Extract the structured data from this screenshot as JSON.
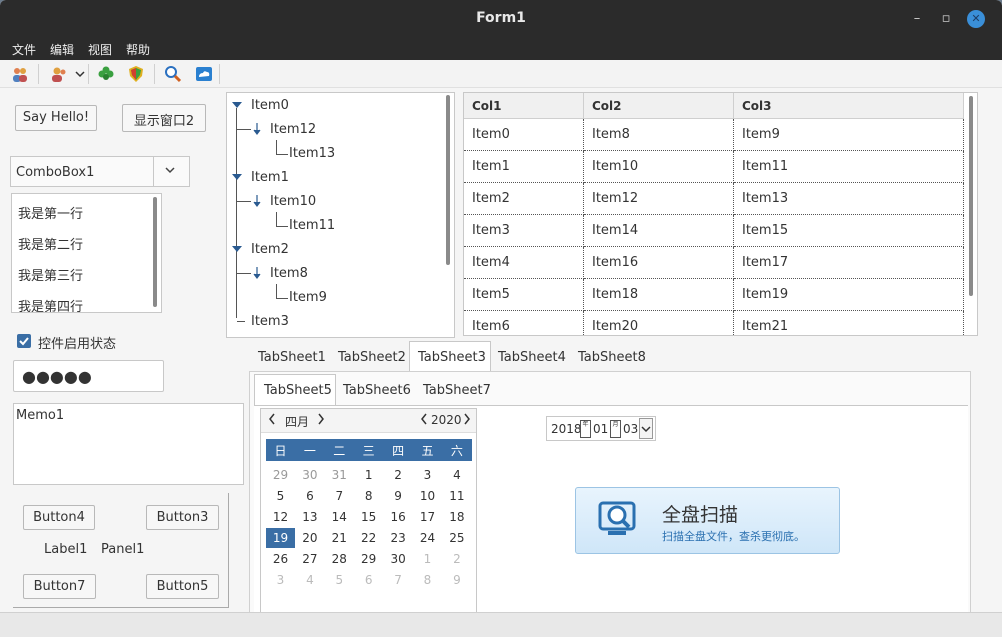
{
  "window": {
    "title": "Form1",
    "minimize": "–",
    "restore": "▫",
    "close": "✕"
  },
  "menu": [
    "文件",
    "编辑",
    "视图",
    "帮助"
  ],
  "toolbar_icons": [
    "users-icon",
    "user-dropdown-icon",
    "clover-icon",
    "shield-icon",
    "search-icon",
    "cloud-icon"
  ],
  "left": {
    "say_hello": "Say Hello!",
    "show_window2": "显示窗口2",
    "combobox": "ComboBox1",
    "listbox": [
      "我是第一行",
      "我是第二行",
      "我是第三行",
      "我是第四行"
    ],
    "checkbox_label": "控件启用状态",
    "password": "●●●●●",
    "memo": "Memo1",
    "button4": "Button4",
    "button3": "Button3",
    "label1": "Label1",
    "panel1": "Panel1",
    "button7": "Button7",
    "button5": "Button5"
  },
  "tree": [
    "Item0",
    "Item12",
    "Item13",
    "Item1",
    "Item10",
    "Item11",
    "Item2",
    "Item8",
    "Item9",
    "Item3"
  ],
  "grid": {
    "headers": [
      "Col1",
      "Col2",
      "Col3"
    ],
    "rows": [
      [
        "Item0",
        "Item8",
        "Item9"
      ],
      [
        "Item1",
        "Item10",
        "Item11"
      ],
      [
        "Item2",
        "Item12",
        "Item13"
      ],
      [
        "Item3",
        "Item14",
        "Item15"
      ],
      [
        "Item4",
        "Item16",
        "Item17"
      ],
      [
        "Item5",
        "Item18",
        "Item19"
      ],
      [
        "Item6",
        "Item20",
        "Item21"
      ]
    ]
  },
  "tabs_outer": [
    "TabSheet1",
    "TabSheet2",
    "TabSheet3",
    "TabSheet4",
    "TabSheet8"
  ],
  "tabs_inner": [
    "TabSheet5",
    "TabSheet6",
    "TabSheet7"
  ],
  "calendar": {
    "month": "四月",
    "year": "2020",
    "weekdays": [
      "日",
      "一",
      "二",
      "三",
      "四",
      "五",
      "六"
    ],
    "weeks": [
      [
        "29",
        "30",
        "31",
        "1",
        "2",
        "3",
        "4"
      ],
      [
        "5",
        "6",
        "7",
        "8",
        "9",
        "10",
        "11"
      ],
      [
        "12",
        "13",
        "14",
        "15",
        "16",
        "17",
        "18"
      ],
      [
        "19",
        "20",
        "21",
        "22",
        "23",
        "24",
        "25"
      ],
      [
        "26",
        "27",
        "28",
        "29",
        "30",
        "1",
        "2"
      ],
      [
        "3",
        "4",
        "5",
        "6",
        "7",
        "8",
        "9"
      ]
    ],
    "selected": "19"
  },
  "date_picker": {
    "year": "2018",
    "month": "01",
    "day": "03"
  },
  "scan_button": {
    "title": "全盘扫描",
    "subtitle": "扫描全盘文件，查杀更彻底。"
  },
  "colors": {
    "accent": "#3a6ea5",
    "titlebar": "#2b2b2b",
    "scan_bg": "#d8ecfa"
  }
}
